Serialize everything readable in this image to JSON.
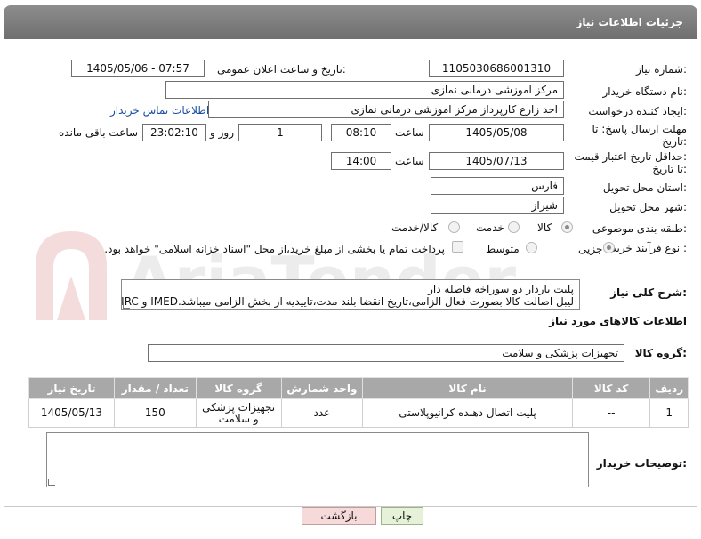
{
  "header": {
    "title": "جزئیات اطلاعات نیاز"
  },
  "fields": {
    "need_number_label": "شماره نیاز:",
    "need_number": "1105030686001310",
    "announce_label": "تاریخ و ساعت اعلان عمومی:",
    "announce_value": "1405/05/06 - 07:57",
    "buyer_org_label": "نام دستگاه خریدار:",
    "buyer_org": "مرکز اموزشی درمانی نمازی",
    "requester_label": "ایجاد کننده درخواست:",
    "requester": "احد زارع کارپرداز مرکز اموزشی درمانی نمازی",
    "contact_link": "اطلاعات تماس خریدار",
    "reply_deadline_label_1": "مهلت ارسال پاسخ: تا",
    "reply_deadline_label_2": "تاریخ:",
    "reply_date": "1405/05/08",
    "time_label": "ساعت",
    "reply_time": "08:10",
    "days_value": "1",
    "days_label": "روز و",
    "remaining_time": "23:02:10",
    "remaining_label": "ساعت باقی مانده",
    "price_valid_label_1": "حداقل تاریخ اعتبار قیمت:",
    "price_valid_label_2": "تا تاریخ:",
    "price_date": "1405/07/13",
    "price_time": "14:00",
    "province_label": "استان محل تحویل:",
    "province": "فارس",
    "city_label": "شهر محل تحویل:",
    "city": "شیراز",
    "category_label": "طبقه بندی موضوعی:",
    "category_options": [
      "کالا",
      "خدمت",
      "کالا/خدمت"
    ],
    "process_label": "نوع فرآیند خرید :",
    "process_options": [
      "جزیی",
      "متوسط"
    ],
    "payment_note": "پرداخت تمام یا بخشی از مبلغ خرید،از محل \"اسناد خزانه اسلامی\" خواهد بود."
  },
  "description": {
    "label": "شرح کلی نیاز:",
    "line1": "پلیت باردار دو سوراخه فاصله دار",
    "line2": "لیبل اصالت کالا بصورت فعال الزامی،تاریخ انقضا بلند مدت،تاییدیه از بخش الزامی میباشد.IMED و IRC معتبر"
  },
  "goods_info": {
    "title": "اطلاعات کالاهای مورد نیاز",
    "group_label": "گروه کالا:",
    "group_value": "تجهیزات پزشکی و سلامت"
  },
  "table": {
    "headers": [
      "ردیف",
      "کد کالا",
      "نام کالا",
      "واحد شمارش",
      "گروه کالا",
      "تعداد / مقدار",
      "تاریخ نیاز"
    ],
    "rows": [
      {
        "row": "1",
        "code": "--",
        "name": "پلیت اتصال دهنده کرانیوپلاستی",
        "unit": "عدد",
        "group": "تجهیزات پزشکی و سلامت",
        "qty": "150",
        "date": "1405/05/13"
      }
    ]
  },
  "notes": {
    "label": "توضیحات خریدار:"
  },
  "buttons": {
    "print": "چاپ",
    "back": "بازگشت"
  },
  "watermark_text": "AriaTender.net"
}
